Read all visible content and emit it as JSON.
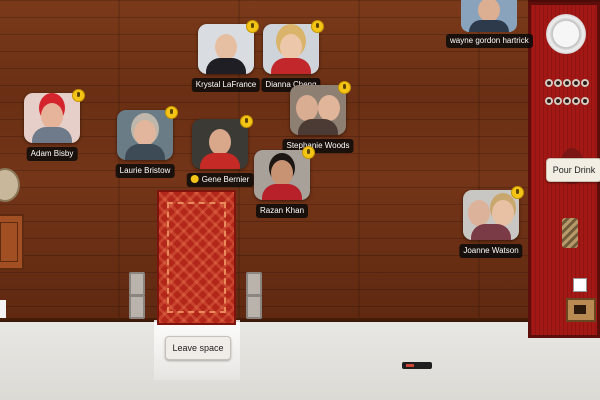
{
  "participants": [
    {
      "name": "wayne gordon hartrick"
    },
    {
      "name": "Krystal LaFrance"
    },
    {
      "name": "Dianna Cheng"
    },
    {
      "name": "Stephanie Woods"
    },
    {
      "name": "Adam Bisby"
    },
    {
      "name": "Laurie Bristow"
    },
    {
      "name": "Gene Bernier"
    },
    {
      "name": "Razan Khan"
    },
    {
      "name": "Joanne Watson"
    }
  ],
  "buttons": {
    "pour_drink": "Pour Drink",
    "leave_space": "Leave space"
  },
  "icons": {
    "mic": "microphone-icon",
    "host": "star-icon"
  },
  "colors": {
    "mic_badge": "#f4c417",
    "bar_cabinet": "#a31814",
    "rug": "#b3261a",
    "floor": "#e9e7e3"
  }
}
